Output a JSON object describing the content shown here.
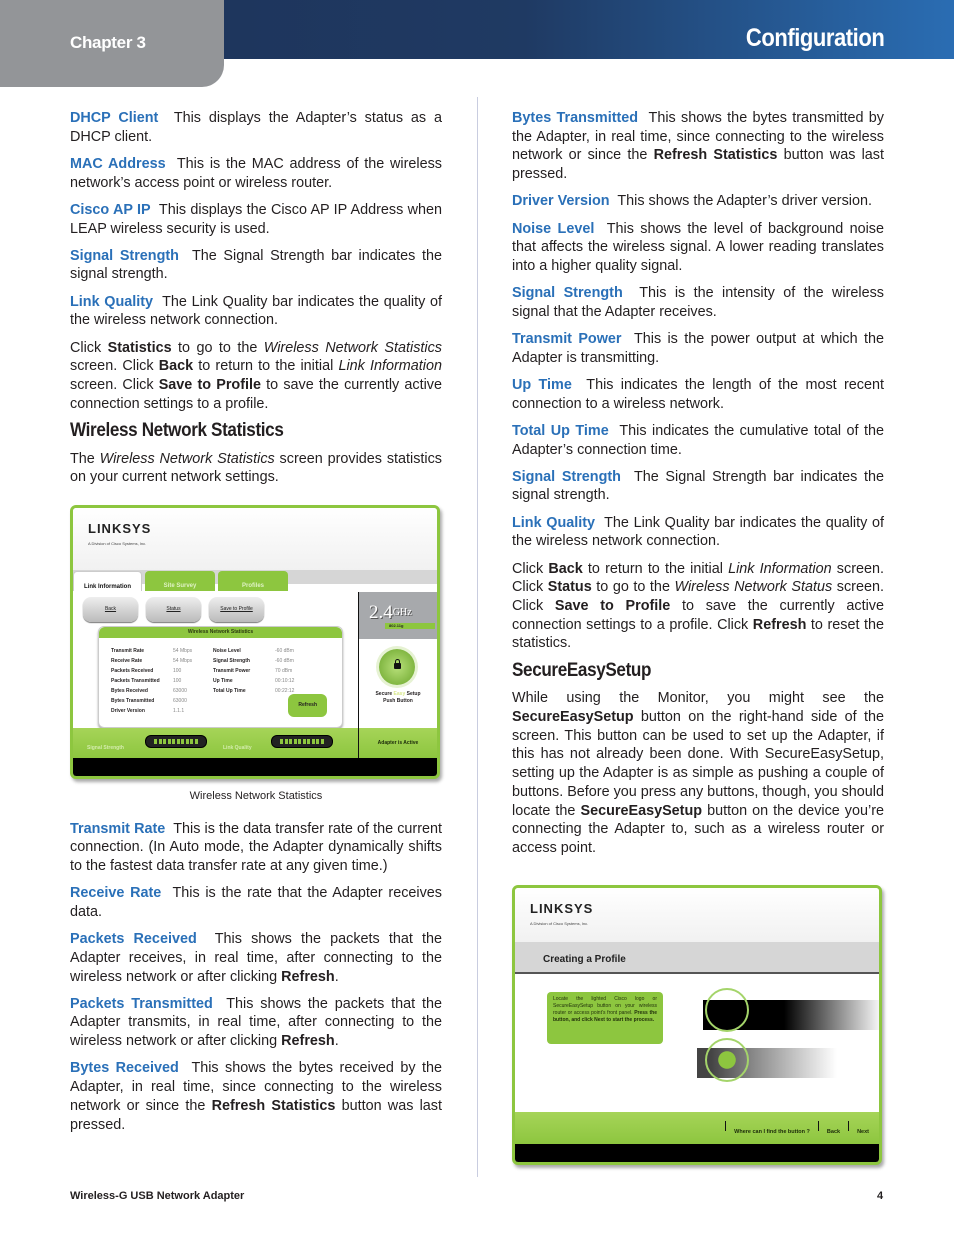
{
  "header": {
    "chapter": "Chapter 3",
    "section": "Configuration"
  },
  "left_column": {
    "definitions_top": [
      {
        "term": "DHCP Client",
        "text": "This displays the Adapter’s status as a DHCP client."
      },
      {
        "term": "MAC Address",
        "text": "This is the MAC address of the wireless network’s access point or wireless router."
      },
      {
        "term": "Cisco AP IP",
        "text": "This displays the Cisco AP IP Address when LEAP wireless security is used."
      },
      {
        "term": "Signal Strength",
        "text": "The Signal Strength bar indicates the signal strength."
      },
      {
        "term": "Link Quality",
        "text": "The Link Quality bar indicates the quality of the wireless network connection."
      }
    ],
    "click_paragraph": {
      "p1": "Click ",
      "b1": "Statistics",
      "p2": " to go to the ",
      "i1": "Wireless Network Statistics",
      "p3": " screen. Click ",
      "b2": "Back",
      "p4": " to return to the initial ",
      "i2": "Link Information",
      "p5": " screen. Click ",
      "b3": "Save to Profile",
      "p6": " to save the currently active connection settings to a profile."
    },
    "section_heading": "Wireless Network Statistics",
    "section_intro": {
      "p1": "The ",
      "i1": "Wireless Network Statistics",
      "p2": " screen provides statistics on your current network settings."
    },
    "figure_caption": "Wireless Network Statistics",
    "definitions_bottom": [
      {
        "term": "Transmit Rate",
        "text": "This is the data transfer rate of the current connection. (In Auto mode, the Adapter dynamically shifts to the fastest data transfer rate at any given time.)"
      },
      {
        "term": "Receive Rate",
        "text": "This is the rate that the Adapter receives data."
      },
      {
        "term": "Packets Received",
        "text": "This shows the packets that the Adapter receives, in real time, after connecting to the wireless network or after clicking ",
        "bold_tail": "Refresh",
        "tail": "."
      },
      {
        "term": "Packets Transmitted",
        "text": "This shows the packets that the Adapter transmits, in real time, after connecting to the wireless network or after clicking ",
        "bold_tail": "Refresh",
        "tail": "."
      },
      {
        "term": "Bytes Received",
        "text": "This shows the bytes received by the Adapter, in real time, since connecting to the wireless network or since the ",
        "bold_tail": "Refresh Statistics",
        "tail": " button was last pressed."
      }
    ]
  },
  "stats_screenshot": {
    "logo": "LINKSYS",
    "logo_sub": "A Division of Cisco Systems, Inc.",
    "tabs": [
      "Link Information",
      "Site Survey",
      "Profiles"
    ],
    "buttons": [
      "Back",
      "Status",
      "Save to Profile"
    ],
    "panel_title": "Wireless Network Statistics",
    "stats_left": [
      {
        "label": "Transmit Rate",
        "value": "54 Mbps"
      },
      {
        "label": "Receive Rate",
        "value": "54 Mbps"
      },
      {
        "label": "Packets Received",
        "value": "100"
      },
      {
        "label": "Packets Transmitted",
        "value": "100"
      },
      {
        "label": "Bytes Received",
        "value": "63000"
      },
      {
        "label": "Bytes Transmitted",
        "value": "63000"
      },
      {
        "label": "Driver Version",
        "value": "1.1.1"
      }
    ],
    "stats_right": [
      {
        "label": "Noise Level",
        "value": "-60 dBm"
      },
      {
        "label": "Signal Strength",
        "value": "-60 dBm"
      },
      {
        "label": "Transmit Power",
        "value": "70 dBm"
      },
      {
        "label": "Up Time",
        "value": "00:10:12"
      },
      {
        "label": "Total Up Time",
        "value": "00:22:12"
      }
    ],
    "refresh_label": "Refresh",
    "band": "2.4",
    "band_unit": "GHz",
    "standard": "802.11g",
    "ses_label_1": "Secure",
    "ses_label_easy": "Easy",
    "ses_label_2": "Setup",
    "ses_label_3": "Push Button",
    "signal_strength_label": "Signal Strength",
    "link_quality_label": "Link Quality",
    "signal_strength_level": 1.0,
    "link_quality_level": 1.0,
    "status": "Adapter is Active"
  },
  "right_column": {
    "definitions": [
      {
        "term": "Bytes Transmitted",
        "text": "This shows the bytes transmitted by the Adapter, in real time, since connecting to the wireless network or since the ",
        "bold_tail": "Refresh Statistics",
        "tail": " button was last pressed."
      },
      {
        "term": "Driver Version",
        "text": "This shows the Adapter’s driver version."
      },
      {
        "term": "Noise Level",
        "text": "This shows the level of background noise that affects the wireless signal. A lower reading translates into a higher quality signal."
      },
      {
        "term": "Signal Strength",
        "text": "This is the intensity of the wireless signal that the Adapter receives."
      },
      {
        "term": "Transmit Power",
        "text": "This is the power output at which the Adapter is transmitting."
      },
      {
        "term": "Up Time",
        "text": "This indicates the length of the most recent connection to a wireless network."
      },
      {
        "term": "Total Up Time",
        "text": "This indicates the cumulative total of the Adapter’s connection time."
      },
      {
        "term": "Signal Strength",
        "text": "The Signal Strength bar indicates the signal strength."
      },
      {
        "term": "Link Quality",
        "text": "The Link Quality bar indicates the quality of the wireless network connection."
      }
    ],
    "click_paragraph": {
      "p1": "Click ",
      "b1": "Back",
      "p2": " to return to the initial ",
      "i1": "Link Information",
      "p3": " screen. Click ",
      "b2": "Status",
      "p4": " to go to the ",
      "i2": "Wireless Network Status",
      "p5": " screen. Click ",
      "b3": "Save to Profile",
      "p6": " to save the currently active connection settings to a profile. Click ",
      "b4": "Refresh",
      "p7": " to reset the statistics."
    },
    "section_heading": "SecureEasySetup",
    "ses_paragraph": {
      "p1": "While using the Monitor, you might see the ",
      "b1": "SecureEasySetup",
      "p2": " button on the right-hand side of the screen. This button can be used to set up the Adapter, if this has not already been done. With SecureEasySetup, setting up the Adapter is as simple as pushing a couple of buttons. Before you press any buttons, though, you should locate the ",
      "b2": "SecureEasySetup",
      "p3": " button on the device you’re connecting the Adapter to, such as a wireless router or access point."
    }
  },
  "profile_screenshot": {
    "logo": "LINKSYS",
    "logo_sub": "A Division of Cisco Systems, Inc.",
    "title": "Creating a Profile",
    "callout_text": "Locate the lighted Cisco logo or SecureEasySetup button on your wireless router or access point’s front panel.",
    "callout_bold": "Press the button, and click Next to start the process.",
    "links": [
      "Where can I find the button ?",
      "Back",
      "Next"
    ]
  },
  "footer": {
    "product": "Wireless-G USB Network Adapter",
    "page": "4"
  },
  "colors": {
    "header_dark": "#1e3258",
    "header_light": "#2a6db3",
    "chapter_tab": "#939598",
    "term_blue": "#2a70b8",
    "linksys_green": "#8dc63f"
  }
}
